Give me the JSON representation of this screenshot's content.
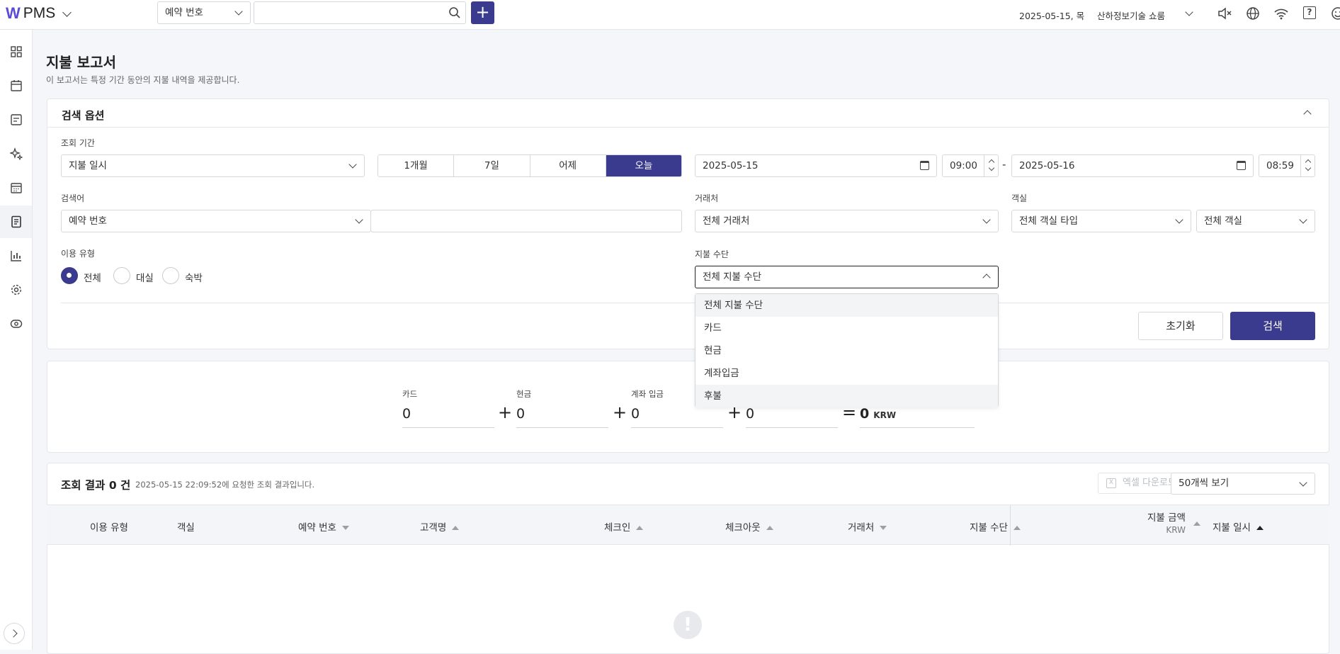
{
  "app": {
    "logo": "W",
    "name": "PMS"
  },
  "topbar": {
    "search_type": "예약 번호",
    "search_value": "",
    "add_label": "+",
    "date": "2025-05-15, 목",
    "property": "산하정보기술 쇼룸",
    "help": "?"
  },
  "page": {
    "title": "지불 보고서",
    "subtitle": "이 보고서는 특정 기간 동안의 지불 내역을 제공합니다."
  },
  "search": {
    "title": "검색 옵션",
    "period_label": "조회 기간",
    "period_type": "지불 일시",
    "quick_ranges": [
      "1개월",
      "7일",
      "어제",
      "오늘"
    ],
    "active_range": "오늘",
    "start_date": "2025-05-15",
    "start_time": "09:00",
    "dash": "-",
    "end_date": "2025-05-16",
    "end_time": "08:59",
    "keyword_label": "검색어",
    "keyword_type": "예약 번호",
    "keyword_value": "",
    "partner_label": "거래처",
    "partner_value": "전체 거래처",
    "room_label": "객실",
    "room_type_value": "전체 객실 타입",
    "room_value": "전체 객실",
    "usage_label": "이용 유형",
    "usage_options": [
      "전체",
      "대실",
      "숙박"
    ],
    "usage_selected": "전체",
    "method_label": "지불 수단",
    "method_value": "전체 지불 수단",
    "method_options": [
      "전체 지불 수단",
      "카드",
      "현금",
      "계좌입금",
      "후불"
    ],
    "reset_label": "초기화",
    "search_label": "검색"
  },
  "summary": {
    "card_label": "카드",
    "card_value": "0",
    "cash_label": "현금",
    "cash_value": "0",
    "transfer_label": "계좌 입금",
    "transfer_value": "0",
    "other_value": "0",
    "plus": "+",
    "equals": "=",
    "total_value": "0",
    "currency": "KRW"
  },
  "results": {
    "title": "조회 결과 0 건",
    "subtitle": "2025-05-15 22:09:52에 요청한 조회 결과입니다.",
    "excel_label": "엑셀 다운로드",
    "excel_icon": "X",
    "page_size": "50개씩 보기",
    "columns": [
      "이용 유형",
      "객실",
      "예약 번호",
      "고객명",
      "체크인",
      "체크아웃",
      "거래처",
      "지불 수단",
      "지불 금액",
      "지불 일시"
    ],
    "amount_unit": "KRW",
    "empty_icon": "!"
  }
}
